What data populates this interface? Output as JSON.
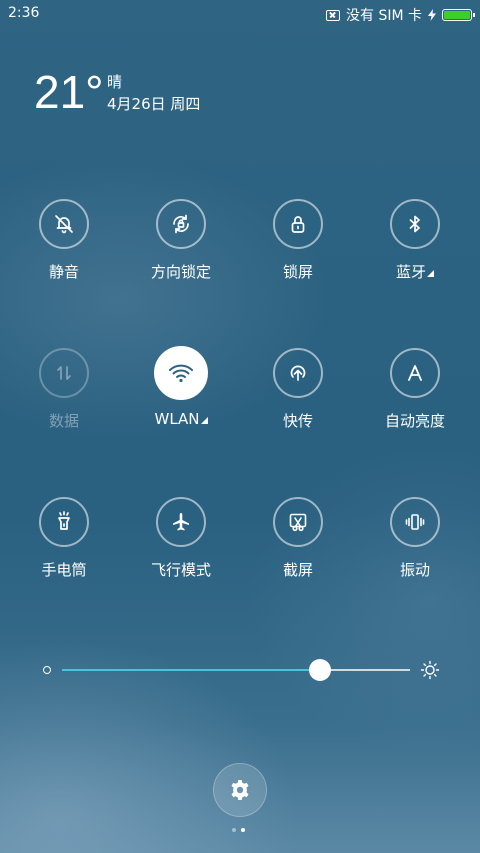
{
  "status_bar": {
    "time": "2:36",
    "sim_text": "没有 SIM 卡",
    "battery_level": 1.0,
    "battery_color": "#3ccf2a"
  },
  "weather": {
    "temperature": "21°",
    "condition": "晴",
    "date": "4月26日 周四"
  },
  "tiles": [
    {
      "label": "静音",
      "icon": "silent-bell-icon",
      "active": false,
      "enabled": true
    },
    {
      "label": "方向锁定",
      "icon": "rotation-lock-icon",
      "active": false,
      "enabled": true
    },
    {
      "label": "锁屏",
      "icon": "lock-icon",
      "active": false,
      "enabled": true
    },
    {
      "label": "蓝牙",
      "icon": "bluetooth-icon",
      "active": false,
      "enabled": true,
      "expandable": true
    },
    {
      "label": "数据",
      "icon": "data-arrows-icon",
      "active": false,
      "enabled": false
    },
    {
      "label": "WLAN",
      "icon": "wifi-icon",
      "active": true,
      "enabled": true,
      "expandable": true
    },
    {
      "label": "快传",
      "icon": "quick-transfer-icon",
      "active": false,
      "enabled": true
    },
    {
      "label": "自动亮度",
      "icon": "auto-brightness-icon",
      "active": false,
      "enabled": true
    },
    {
      "label": "手电筒",
      "icon": "flashlight-icon",
      "active": false,
      "enabled": true
    },
    {
      "label": "飞行模式",
      "icon": "airplane-icon",
      "active": false,
      "enabled": true
    },
    {
      "label": "截屏",
      "icon": "screenshot-icon",
      "active": false,
      "enabled": true
    },
    {
      "label": "振动",
      "icon": "vibrate-icon",
      "active": false,
      "enabled": true
    }
  ],
  "brightness": {
    "level": 0.74,
    "fill_color": "#49c3dd"
  },
  "footer": {
    "settings_icon": "gear-icon",
    "page_count": 2,
    "current_page": 2
  }
}
